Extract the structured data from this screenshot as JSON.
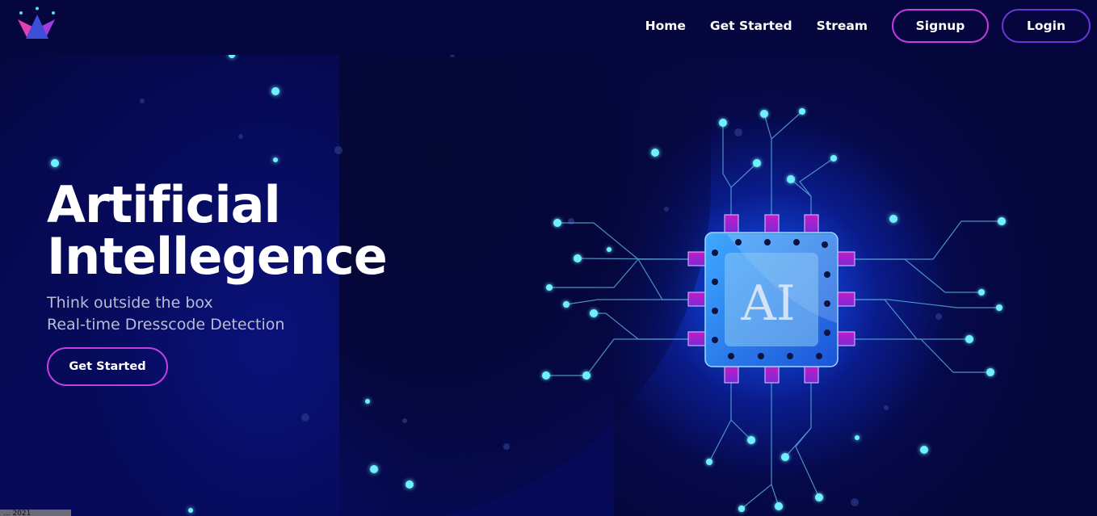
{
  "nav": {
    "home": "Home",
    "get_started": "Get Started",
    "stream": "Stream",
    "signup": "Signup",
    "login": "Login"
  },
  "hero": {
    "title_line1": "Artificial",
    "title_line2": "Intellegence",
    "subtitle_line1": "Think outside the box",
    "subtitle_line2": "Real-time Dresscode Detection",
    "cta": "Get Started"
  },
  "chip": {
    "label": "AI"
  },
  "footer": {
    "text": "... 2021"
  },
  "colors": {
    "accent_pink": "#c33ee0",
    "accent_purple": "#6a36d8",
    "dot_cyan": "#6ff0ff",
    "bg_dark": "#04063a"
  }
}
